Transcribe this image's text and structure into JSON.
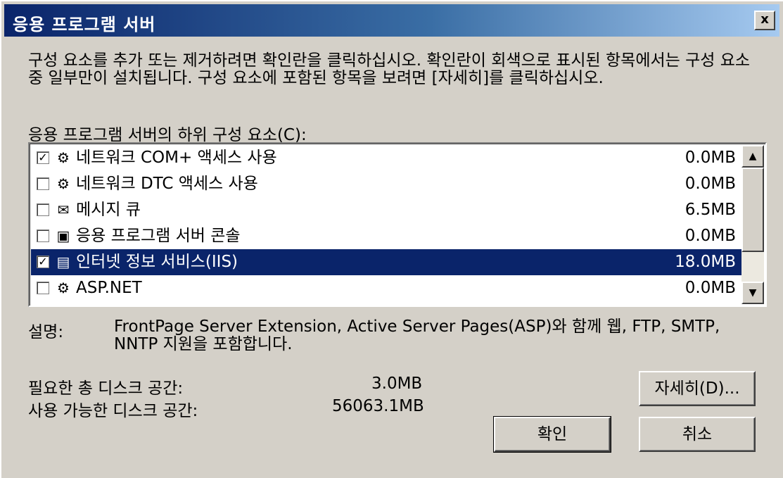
{
  "window": {
    "title": "응용 프로그램 서버",
    "close_label": "x"
  },
  "instruction": "구성 요소를 추가 또는 제거하려면 확인란을 클릭하십시오. 확인란이 회색으로 표시된 항목에서는 구성 요소 중 일부만이 설치됩니다. 구성 요소에 포함된 항목을 보려면 [자세히]를 클릭하십시오.",
  "list_label": "응용 프로그램 서버의 하위 구성 요소(C):",
  "components": [
    {
      "label": "네트워크 COM+ 액세스 사용",
      "size": "0.0MB",
      "checked": true,
      "icon": "network-com-icon"
    },
    {
      "label": "네트워크 DTC 액세스 사용",
      "size": "0.0MB",
      "checked": false,
      "icon": "network-dtc-icon"
    },
    {
      "label": "메시지 큐",
      "size": "6.5MB",
      "checked": false,
      "icon": "message-queue-icon"
    },
    {
      "label": "응용 프로그램 서버 콘솔",
      "size": "0.0MB",
      "checked": false,
      "icon": "app-server-console-icon"
    },
    {
      "label": "인터넷 정보 서비스(IIS)",
      "size": "18.0MB",
      "checked": true,
      "icon": "iis-icon",
      "selected": true
    },
    {
      "label": "ASP.NET",
      "size": "0.0MB",
      "checked": false,
      "icon": "aspnet-icon"
    }
  ],
  "description": {
    "label": "설명:",
    "text": "FrontPage Server Extension, Active Server Pages(ASP)와 함께 웹, FTP, SMTP, NNTP 지원을 포함합니다."
  },
  "disk": {
    "required_label": "필요한 총 디스크 공간:",
    "required_value": "3.0MB",
    "available_label": "사용 가능한 디스크 공간:",
    "available_value": "56063.1MB"
  },
  "buttons": {
    "details": "자세히(D)...",
    "ok": "확인",
    "cancel": "취소"
  },
  "colors": {
    "dialog_bg": "#d4d0c8",
    "titlebar": "#0a246a",
    "selection": "#0a246a"
  }
}
